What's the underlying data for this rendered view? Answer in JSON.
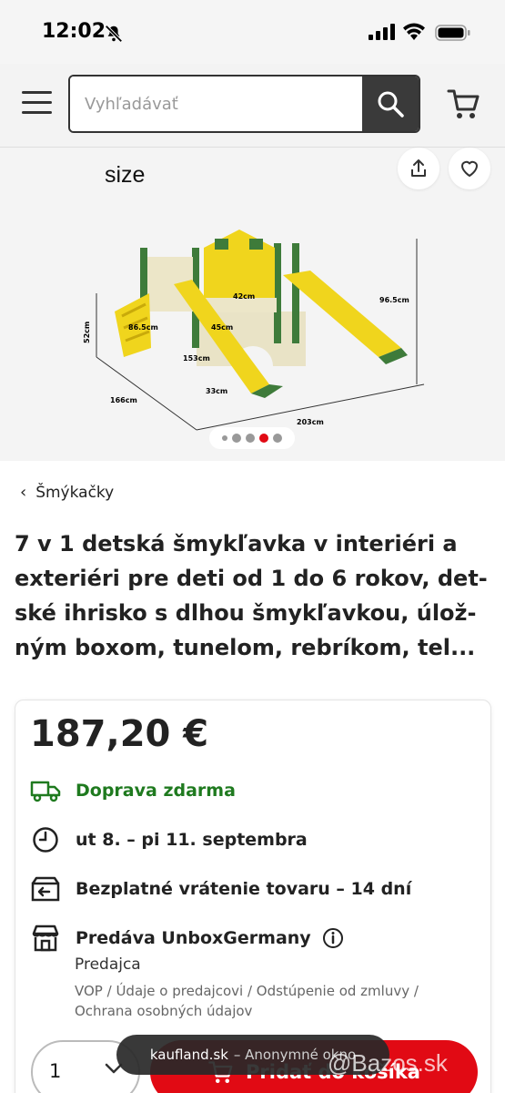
{
  "status_bar": {
    "time": "12:02"
  },
  "header": {
    "search_placeholder": "Vyhľadávať"
  },
  "gallery": {
    "image_caption": "size",
    "dimensions": [
      "42cm",
      "96.5cm",
      "86.5cm",
      "45cm",
      "52cm",
      "153cm",
      "33cm",
      "166cm",
      "203cm"
    ],
    "active_dot": 4
  },
  "breadcrumb": {
    "label": "Šmýkačky"
  },
  "product": {
    "title": "7 v 1 detská šmykľavka v interiéri a exteriéri pre deti od 1 do 6 rokov, det-ské ihrisko s dlhou šmykľavkou, úlož-ným boxom, tunelom, rebríkom, tel..."
  },
  "offer": {
    "price": "187,20 €",
    "shipping": "Doprava zdarma",
    "delivery": "ut 8. – pi 11. septembra",
    "returns": "Bezplatné vrátenie tovaru – 14 dní",
    "seller": "Predáva UnboxGermany",
    "seller_role": "Predajca",
    "seller_links": "VOP / Údaje o predajcovi / Odstúpenie od zmluvy / Ochrana osobných údajov"
  },
  "cart": {
    "quantity": "1",
    "add_label": "Pridať do košíka"
  },
  "browser": {
    "domain": "kaufland.sk",
    "mode": "– Anonymné okno"
  },
  "watermark": "@Bazos.sk",
  "colors": {
    "accent": "#e10a14",
    "green": "#1f7a1f"
  }
}
